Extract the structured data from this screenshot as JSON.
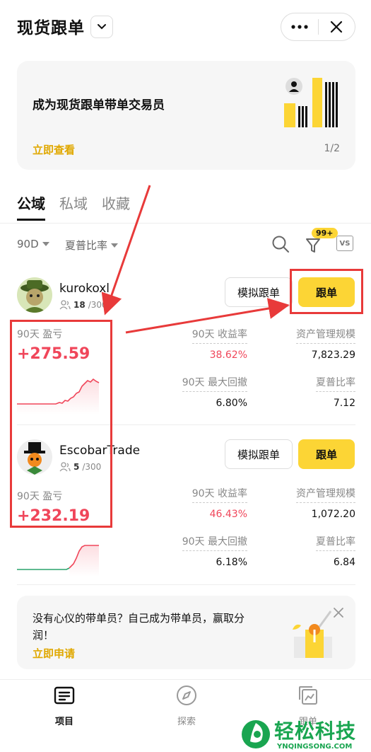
{
  "header": {
    "title": "现货跟单",
    "more_icon": "more-dots-icon",
    "close_icon": "close-icon"
  },
  "banner": {
    "title": "成为现货跟单带单交易员",
    "link": "立即查看",
    "page_indicator": "1/2"
  },
  "tabs": [
    {
      "label": "公域",
      "active": true
    },
    {
      "label": "私域",
      "active": false
    },
    {
      "label": "收藏",
      "active": false
    }
  ],
  "filters": {
    "period": "90D",
    "sort": "夏普比率",
    "badge": "99+",
    "vs_label": "VS"
  },
  "traders": [
    {
      "name": "kurokoxl",
      "followers": "18",
      "followers_max": "/300",
      "sim_button": "模拟跟单",
      "follow_button": "跟单",
      "pnl_label": "90天 盈亏",
      "pnl_value": "+275.59",
      "stats": {
        "return_label": "90天 收益率",
        "return_value": "38.62%",
        "aum_label": "资产管理规模",
        "aum_value": "7,823.29",
        "drawdown_label": "90天 最大回撤",
        "drawdown_value": "6.80%",
        "sharpe_label": "夏普比率",
        "sharpe_value": "7.12"
      }
    },
    {
      "name": "EscobarTrade",
      "followers": "5",
      "followers_max": "/300",
      "sim_button": "模拟跟单",
      "follow_button": "跟单",
      "pnl_label": "90天 盈亏",
      "pnl_value": "+232.19",
      "stats": {
        "return_label": "90天 收益率",
        "return_value": "46.43%",
        "aum_label": "资产管理规模",
        "aum_value": "1,072.20",
        "drawdown_label": "90天 最大回撤",
        "drawdown_value": "6.18%",
        "sharpe_label": "夏普比率",
        "sharpe_value": "6.84"
      }
    }
  ],
  "promo": {
    "text": "没有心仪的带单员？自己成为带单员，赢取分润！",
    "link": "立即申请"
  },
  "bottom_nav": [
    {
      "label": "项目",
      "icon": "list-icon",
      "active": true
    },
    {
      "label": "探索",
      "icon": "compass-icon",
      "active": false
    },
    {
      "label": "跟单",
      "icon": "copy-trade-icon",
      "active": false
    }
  ],
  "watermark": {
    "text": "轻松科技",
    "sub": "YNQINGSONG.COM"
  },
  "colors": {
    "accent": "#fcd535",
    "profit": "#f0465a",
    "link": "#e0a800",
    "annotation": "#e83a3a"
  }
}
